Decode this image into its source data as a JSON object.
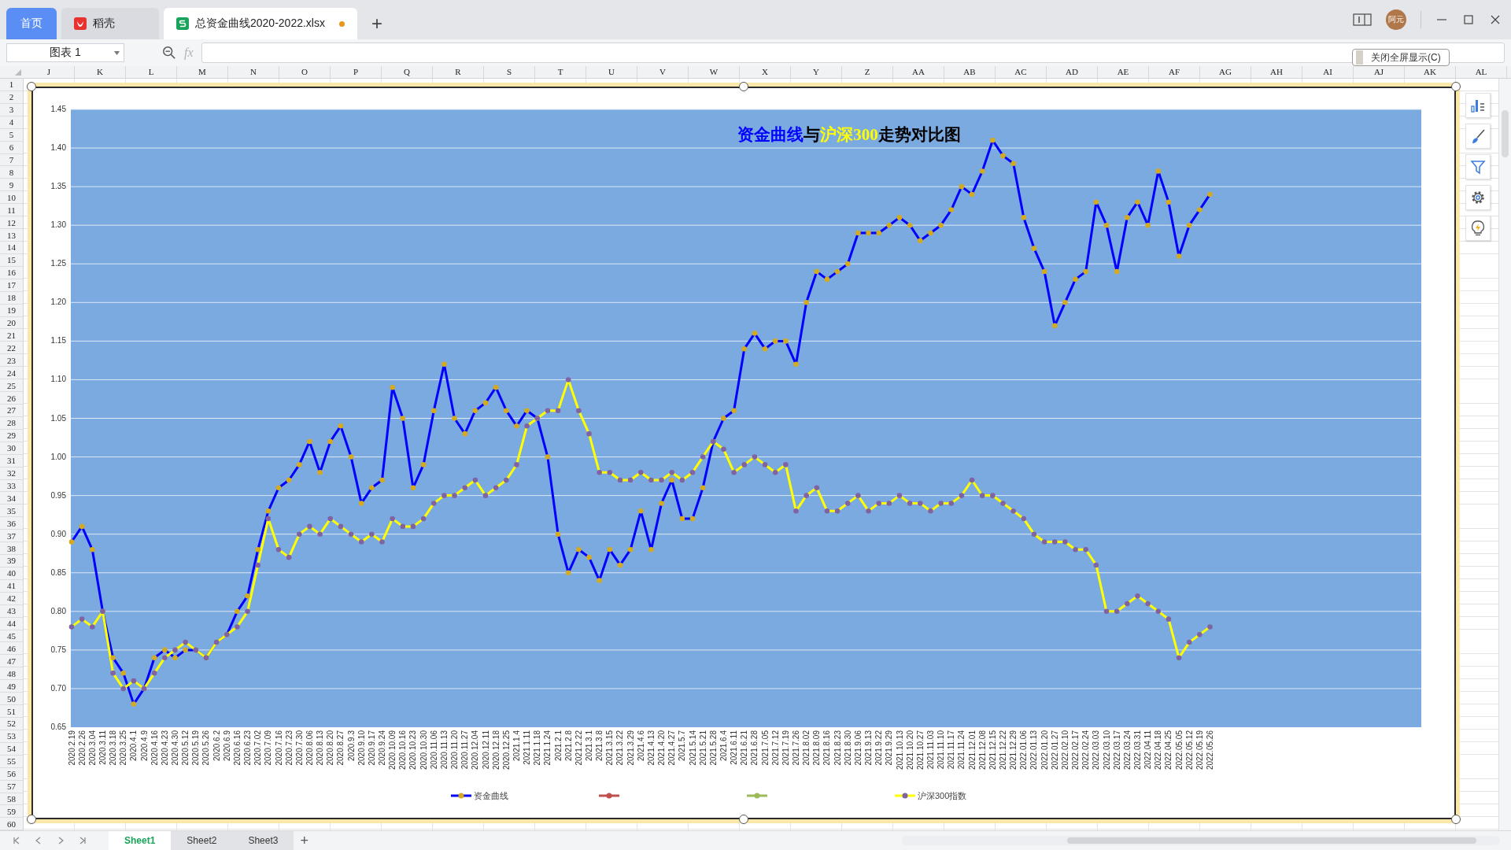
{
  "tabs": [
    {
      "label": "首页",
      "kind": "home",
      "selected": false
    },
    {
      "label": "稻壳",
      "kind": "docer",
      "selected": false
    },
    {
      "label": "总资金曲线2020-2022.xlsx",
      "kind": "sheet",
      "selected": true,
      "unsaved": true
    }
  ],
  "new_tab": "+",
  "account": {
    "avatar_text": "阿元"
  },
  "name_box": {
    "value": "图表 1"
  },
  "formula": {
    "label": "fx"
  },
  "columns": [
    "J",
    "K",
    "L",
    "M",
    "N",
    "O",
    "P",
    "Q",
    "R",
    "S",
    "T",
    "U",
    "V",
    "W",
    "X",
    "Y",
    "Z",
    "AA",
    "AB",
    "AC",
    "AD",
    "AE",
    "AF",
    "AG",
    "AH",
    "AI",
    "AJ",
    "AK",
    "AL"
  ],
  "rows": [
    "1",
    "2",
    "3",
    "4",
    "5",
    "6",
    "7",
    "8",
    "9",
    "10",
    "11",
    "12",
    "13",
    "14",
    "15",
    "16",
    "17",
    "18",
    "19",
    "20",
    "21",
    "22",
    "23",
    "24",
    "25",
    "26",
    "27",
    "28",
    "29",
    "30",
    "31",
    "32",
    "33",
    "34",
    "35",
    "36",
    "37",
    "38",
    "39",
    "40",
    "41",
    "42",
    "43",
    "44",
    "45",
    "46",
    "47",
    "48",
    "49",
    "50",
    "51",
    "52",
    "53",
    "54",
    "55",
    "56",
    "57",
    "58",
    "59",
    "60"
  ],
  "fullscreen_tip": "关闭全屏显示(C)",
  "chart": {
    "title_parts": [
      {
        "text": "资金曲线",
        "color": "#0000ff"
      },
      {
        "text": "与",
        "color": "#000000"
      },
      {
        "text": "沪深300",
        "color": "#ffff00"
      },
      {
        "text": "走势对比图",
        "color": "#000000"
      }
    ],
    "chart_data": {
      "type": "line",
      "categories": [
        "2020.2.19",
        "2020.2.26",
        "2020.3.04",
        "2020.3.11",
        "2020.3.18",
        "2020.3.25",
        "2020.4.1",
        "2020.4.9",
        "2020.4.16",
        "2020.4.23",
        "2020.4.30",
        "2020.5.12",
        "2020.5.19",
        "2020.5.26",
        "2020.6.2",
        "2020.6.9",
        "2020.6.16",
        "2020.6.23",
        "2020.7.02",
        "2020.7.09",
        "2020.7.16",
        "2020.7.23",
        "2020.7.30",
        "2020.8.06",
        "2020.8.13",
        "2020.8.20",
        "2020.8.27",
        "2020.9.3",
        "2020.9.10",
        "2020.9.17",
        "2020.9.24",
        "2020.10.09",
        "2020.10.16",
        "2020.10.23",
        "2020.10.30",
        "2020.11.06",
        "2020.11.13",
        "2020.11.20",
        "2020.11.27",
        "2020.12.04",
        "2020.12.11",
        "2020.12.18",
        "2020.12.25",
        "2021.1.4",
        "2021.1.11",
        "2021.1.18",
        "2021.1.24",
        "2021.2.1",
        "2021.2.8",
        "2021.2.22",
        "2021.3.1",
        "2021.3.8",
        "2021.3.15",
        "2021.3.22",
        "2021.3.29",
        "2021.4.6",
        "2021.4.13",
        "2021.4.20",
        "2021.4.27",
        "2021.5.7",
        "2021.5.14",
        "2021.5.21",
        "2021.5.28",
        "2021.6.4",
        "2021.6.11",
        "2021.6.21",
        "2021.6.28",
        "2021.7.05",
        "2021.7.12",
        "2021.7.19",
        "2021.7.26",
        "2021.8.02",
        "2021.8.09",
        "2021.8.16",
        "2021.8.23",
        "2021.8.30",
        "2021.9.06",
        "2021.9.13",
        "2021.9.22",
        "2021.9.29",
        "2021.10.13",
        "2021.10.20",
        "2021.10.27",
        "2021.11.03",
        "2021.11.10",
        "2021.11.17",
        "2021.11.24",
        "2021.12.01",
        "2021.12.08",
        "2021.12.15",
        "2021.12.22",
        "2021.12.29",
        "2022.01.06",
        "2022.01.13",
        "2022.01.20",
        "2022.01.27",
        "2022.02.10",
        "2022.02.17",
        "2022.02.24",
        "2022.03.03",
        "2022.03.10",
        "2022.03.17",
        "2022.03.24",
        "2022.03.31",
        "2022.04.11",
        "2022.04.18",
        "2022.04.25",
        "2022.05.05",
        "2022.05.12",
        "2022.05.19",
        "2022.05.26"
      ],
      "series": [
        {
          "name": "资金曲线",
          "color": "#0000ff",
          "marker": {
            "color": "#d4aa20"
          },
          "values": [
            0.89,
            0.91,
            0.88,
            0.8,
            0.74,
            0.72,
            0.68,
            0.7,
            0.74,
            0.75,
            0.74,
            0.75,
            0.75,
            0.74,
            0.76,
            0.77,
            0.8,
            0.82,
            0.88,
            0.93,
            0.96,
            0.97,
            0.99,
            1.02,
            0.98,
            1.02,
            1.04,
            1.0,
            0.94,
            0.96,
            0.97,
            1.09,
            1.05,
            0.96,
            0.99,
            1.06,
            1.12,
            1.05,
            1.03,
            1.06,
            1.07,
            1.09,
            1.06,
            1.04,
            1.06,
            1.05,
            1.0,
            0.9,
            0.85,
            0.88,
            0.87,
            0.84,
            0.88,
            0.86,
            0.88,
            0.93,
            0.88,
            0.94,
            0.97,
            0.92,
            0.92,
            0.96,
            1.02,
            1.05,
            1.06,
            1.14,
            1.16,
            1.14,
            1.15,
            1.15,
            1.12,
            1.2,
            1.24,
            1.23,
            1.24,
            1.25,
            1.29,
            1.29,
            1.29,
            1.3,
            1.31,
            1.3,
            1.28,
            1.29,
            1.3,
            1.32,
            1.35,
            1.34,
            1.37,
            1.41,
            1.39,
            1.38,
            1.31,
            1.27,
            1.24,
            1.17,
            1.2,
            1.23,
            1.24,
            1.33,
            1.3,
            1.24,
            1.31,
            1.33,
            1.3,
            1.37,
            1.33,
            1.26,
            1.3,
            1.32,
            1.34
          ]
        },
        {
          "color": "#c0504d",
          "marker": {
            "color": "#c0504d"
          },
          "values": [
            null,
            null,
            null,
            null,
            null,
            null,
            null,
            null,
            null,
            null,
            null,
            null,
            null,
            null,
            null,
            null,
            null,
            null,
            null,
            null,
            null,
            null,
            null,
            null,
            null,
            null,
            null,
            null,
            null,
            null,
            null,
            null,
            null,
            null,
            null,
            null,
            null,
            null,
            null,
            null,
            null,
            null,
            null,
            null,
            null,
            null,
            null,
            null,
            null,
            null,
            null,
            null,
            null,
            null,
            null,
            null,
            null,
            null,
            null,
            null,
            null,
            null,
            null,
            null,
            null,
            null,
            null,
            null,
            null,
            null,
            null,
            null,
            null,
            null,
            null,
            null,
            null,
            null,
            null,
            null,
            null,
            null,
            null,
            null,
            null,
            null,
            null,
            null,
            null,
            null,
            null,
            null,
            null,
            null,
            null,
            null,
            null,
            null,
            null,
            null,
            null,
            null,
            null,
            null,
            null,
            null,
            null,
            null,
            null,
            null,
            null
          ]
        },
        {
          "color": "#9bbb59",
          "marker": {
            "color": "#9bbb59"
          },
          "values": [
            null,
            null,
            null,
            null,
            null,
            null,
            null,
            null,
            null,
            null,
            null,
            null,
            null,
            null,
            null,
            null,
            null,
            null,
            null,
            null,
            null,
            null,
            null,
            null,
            null,
            null,
            null,
            null,
            null,
            null,
            null,
            null,
            null,
            null,
            null,
            null,
            null,
            null,
            null,
            null,
            null,
            null,
            null,
            null,
            null,
            null,
            null,
            null,
            null,
            null,
            null,
            null,
            null,
            null,
            null,
            null,
            null,
            null,
            null,
            null,
            null,
            null,
            null,
            null,
            null,
            null,
            null,
            null,
            null,
            null,
            null,
            null,
            null,
            null,
            null,
            null,
            null,
            null,
            null,
            null,
            null,
            null,
            null,
            null,
            null,
            null,
            null,
            null,
            null,
            null,
            null,
            null,
            null,
            null,
            null,
            null,
            null,
            null,
            null,
            null,
            null,
            null,
            null,
            null,
            null,
            null,
            null,
            null,
            null,
            null,
            null
          ]
        },
        {
          "name": "沪深300指数",
          "color": "#ffff00",
          "marker": {
            "color": "#8064a2"
          },
          "values": [
            0.78,
            0.79,
            0.78,
            0.8,
            0.72,
            0.7,
            0.71,
            0.7,
            0.72,
            0.74,
            0.75,
            0.76,
            0.75,
            0.74,
            0.76,
            0.77,
            0.78,
            0.8,
            0.86,
            0.92,
            0.88,
            0.87,
            0.9,
            0.91,
            0.9,
            0.92,
            0.91,
            0.9,
            0.89,
            0.9,
            0.89,
            0.92,
            0.91,
            0.91,
            0.92,
            0.94,
            0.95,
            0.95,
            0.96,
            0.97,
            0.95,
            0.96,
            0.97,
            0.99,
            1.04,
            1.05,
            1.06,
            1.06,
            1.1,
            1.06,
            1.03,
            0.98,
            0.98,
            0.97,
            0.97,
            0.98,
            0.97,
            0.97,
            0.98,
            0.97,
            0.98,
            1.0,
            1.02,
            1.01,
            0.98,
            0.99,
            1.0,
            0.99,
            0.98,
            0.99,
            0.93,
            0.95,
            0.96,
            0.93,
            0.93,
            0.94,
            0.95,
            0.93,
            0.94,
            0.94,
            0.95,
            0.94,
            0.94,
            0.93,
            0.94,
            0.94,
            0.95,
            0.97,
            0.95,
            0.95,
            0.94,
            0.93,
            0.92,
            0.9,
            0.89,
            0.89,
            0.89,
            0.88,
            0.88,
            0.86,
            0.8,
            0.8,
            0.81,
            0.82,
            0.81,
            0.8,
            0.79,
            0.74,
            0.76,
            0.77,
            0.78
          ]
        }
      ],
      "grid": true,
      "legend": true,
      "ylim": [
        0.65,
        1.45
      ],
      "yticks": [
        {
          "value": 0.65,
          "label": "0.65"
        },
        {
          "value": 0.7,
          "label": "0.70"
        },
        {
          "value": 0.75,
          "label": "0.75"
        },
        {
          "value": 0.8,
          "label": "0.80"
        },
        {
          "value": 0.85,
          "label": "0.85"
        },
        {
          "value": 0.9,
          "label": "0.90"
        },
        {
          "value": 0.95,
          "label": "0.95"
        },
        {
          "value": 1.0,
          "label": "1.00"
        },
        {
          "value": 1.05,
          "label": "1.05"
        },
        {
          "value": 1.1,
          "label": "1.10"
        },
        {
          "value": 1.15,
          "label": "1.15"
        },
        {
          "value": 1.2,
          "label": "1.20"
        },
        {
          "value": 1.25,
          "label": "1.25"
        },
        {
          "value": 1.3,
          "label": "1.30"
        },
        {
          "value": 1.35,
          "label": "1.35"
        },
        {
          "value": 1.4,
          "label": "1.40"
        },
        {
          "value": 1.45,
          "label": "1.45"
        }
      ]
    }
  },
  "sheet_tabs": [
    {
      "label": "Sheet1",
      "selected": true
    },
    {
      "label": "Sheet2",
      "selected": false
    },
    {
      "label": "Sheet3",
      "selected": false
    }
  ],
  "add_sheet": "+"
}
